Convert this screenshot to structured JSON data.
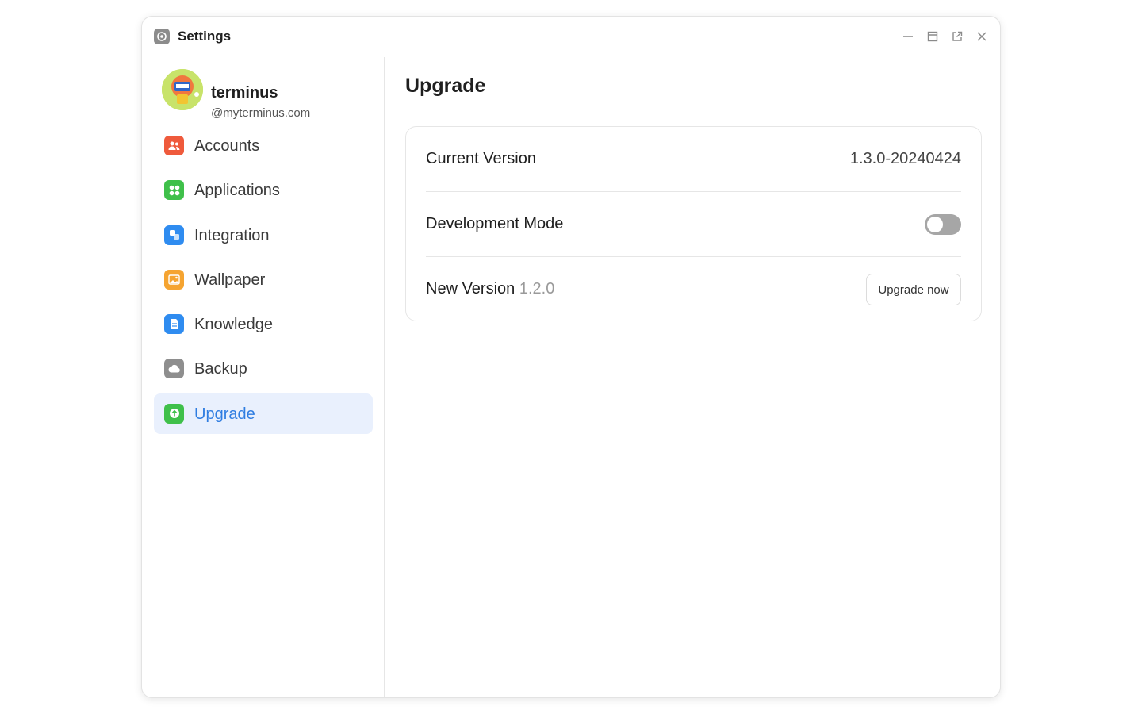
{
  "window": {
    "title": "Settings"
  },
  "profile": {
    "name": "terminus",
    "domain": "@myterminus.com"
  },
  "sidebar": {
    "items": [
      {
        "label": "Accounts",
        "icon": "accounts-icon",
        "color": "#ef5a3c"
      },
      {
        "label": "Applications",
        "icon": "applications-icon",
        "color": "#3fc04a"
      },
      {
        "label": "Integration",
        "icon": "integration-icon",
        "color": "#2f8cf0"
      },
      {
        "label": "Wallpaper",
        "icon": "wallpaper-icon",
        "color": "#f5a431"
      },
      {
        "label": "Knowledge",
        "icon": "knowledge-icon",
        "color": "#2f8cf0"
      },
      {
        "label": "Backup",
        "icon": "backup-icon",
        "color": "#8e8e8e"
      },
      {
        "label": "Upgrade",
        "icon": "upgrade-icon",
        "color": "#3fc04a",
        "active": true
      }
    ]
  },
  "main": {
    "title": "Upgrade",
    "current_version_label": "Current Version",
    "current_version_value": "1.3.0-20240424",
    "dev_mode_label": "Development Mode",
    "dev_mode_enabled": false,
    "new_version_label": "New Version",
    "new_version_value": "1.2.0",
    "upgrade_button": "Upgrade now"
  },
  "colors": {
    "accent": "#2f7de1",
    "active_bg": "#e9f0fd",
    "toggle_off": "#a6a6a6"
  }
}
